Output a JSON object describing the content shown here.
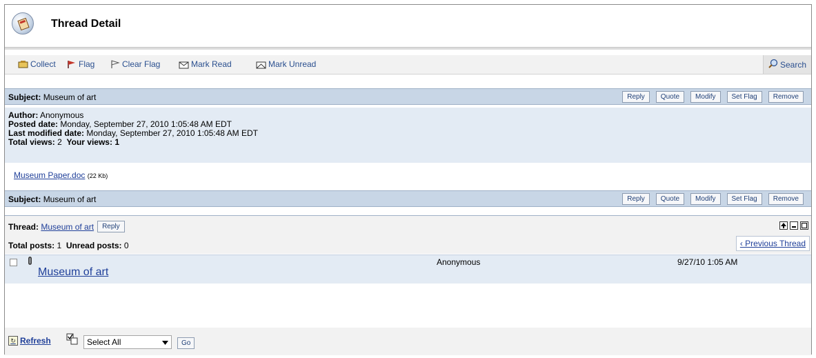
{
  "header": {
    "title": "Thread Detail"
  },
  "toolbar": {
    "collect": "Collect",
    "flag": "Flag",
    "clear_flag": "Clear Flag",
    "mark_read": "Mark Read",
    "mark_unread": "Mark Unread",
    "search": "Search"
  },
  "message": {
    "subject_label": "Subject:",
    "subject": "Museum of art",
    "buttons": {
      "reply": "Reply",
      "quote": "Quote",
      "modify": "Modify",
      "set_flag": "Set Flag",
      "remove": "Remove"
    },
    "author_label": "Author:",
    "author": "Anonymous",
    "posted_label": "Posted date:",
    "posted": "Monday, September 27, 2010 1:05:48 AM EDT",
    "modified_label": "Last modified date:",
    "modified": "Monday, September 27, 2010 1:05:48 AM EDT",
    "total_views_label": "Total views:",
    "total_views": "2",
    "your_views_label": "Your views:",
    "your_views": "1",
    "attachment": {
      "name": "Museum Paper.doc",
      "size": "(22 Kb)"
    }
  },
  "thread": {
    "label": "Thread:",
    "title": "Museum of art",
    "reply": "Reply",
    "total_posts_label": "Total posts:",
    "total_posts": "1",
    "unread_posts_label": "Unread posts:",
    "unread_posts": "0",
    "prev_thread": "‹ Previous Thread",
    "posts": [
      {
        "title": "Museum of art",
        "author": "Anonymous",
        "date": "9/27/10 1:05 AM"
      }
    ]
  },
  "footer": {
    "refresh": "Refresh",
    "select_value": "Select All",
    "go": "Go"
  },
  "colors": {
    "bar": "#c8d6e6",
    "panel": "#e3ebf4",
    "link": "#1f3f99"
  }
}
